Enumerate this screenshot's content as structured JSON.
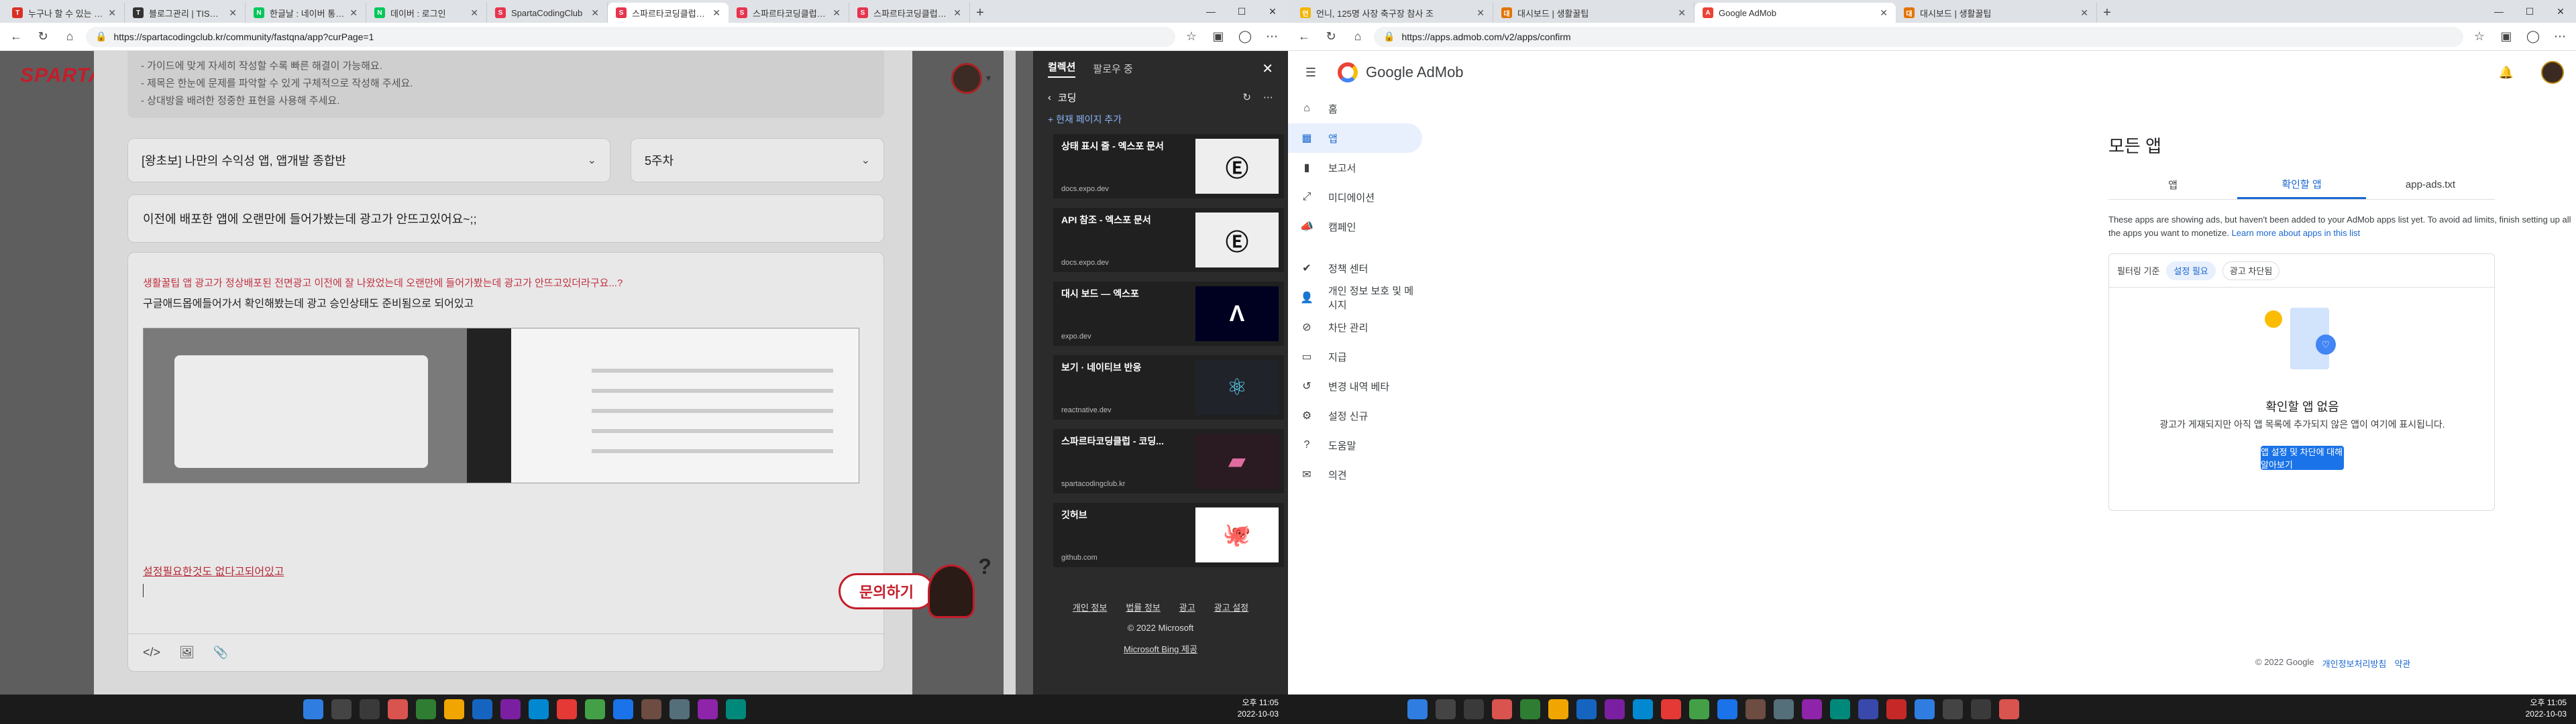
{
  "left": {
    "tabs": [
      {
        "label": "누구나 할 수 있는 앱 광고",
        "color": "#d93025",
        "icon": "T"
      },
      {
        "label": "블로그관리 | TISTORY",
        "color": "#333333",
        "icon": "T"
      },
      {
        "label": "한글날 : 네이버 통합검색",
        "color": "#03c75a",
        "icon": "N"
      },
      {
        "label": "데이버 : 로그인",
        "color": "#03c75a",
        "icon": "N"
      },
      {
        "label": "SpartaCodingClub",
        "color": "#e8344e",
        "icon": "S"
      },
      {
        "label": "스파르타코딩클럽 | 커뮤니",
        "color": "#e8344e",
        "icon": "S"
      },
      {
        "label": "스파르타코딩클럽 | 커뮤니",
        "color": "#e8344e",
        "icon": "S"
      },
      {
        "label": "스파르타코딩클럽 | 커뮤니",
        "color": "#e8344e",
        "icon": "S"
      }
    ],
    "url": "https://spartacodingclub.kr/community/fastqna/app?curPage=1",
    "brand": "SPARTA",
    "guide": [
      "- 가이드에 맞게 자세히 작성할 수록 빠른 해결이 가능해요.",
      "- 제목은 한눈에 문제를 파악할 수 있게 구체적으로 작성해 주세요.",
      "- 상대방을 배려한 정중한 표현을 사용해 주세요."
    ],
    "course": "[왕초보] 나만의 수익성 앱, 앱개발 종합반",
    "week": "5주차",
    "title": "이전에 배포한 앱에 오랜만에 들어가봤는데 광고가 안뜨고있어요~;;",
    "body1": "생활꿀팁 앱 광고가 정상배포된 전면광고 이전에 잘 나왔었는데 오랜만에 들어가봤는데 광고가 안뜨고있더라구요...?",
    "body2": "구글애드몹에들어가서 확인해봤는데 광고 승인상태도 준비됨으로 되어있고",
    "body3": "설정필요한것도 없다고되어있고",
    "ask": "문의하기",
    "collection": {
      "tab1": "컬렉션",
      "tab2": "팔로우 중",
      "name": "코딩",
      "add": "+ 현재 페이지 추가",
      "items": [
        {
          "title": "상태 표시 줄 - 엑스포 문서",
          "domain": "docs.expo.dev",
          "thumb": "Ⓔ",
          "bg": "#eeeeee",
          "fg": "#111111"
        },
        {
          "title": "API 참조 - 엑스포 문서",
          "domain": "docs.expo.dev",
          "thumb": "Ⓔ",
          "bg": "#eeeeee",
          "fg": "#111111"
        },
        {
          "title": "대시 보드 — 엑스포",
          "domain": "expo.dev",
          "thumb": "Λ",
          "bg": "#000020",
          "fg": "#ffffff"
        },
        {
          "title": "보기 · 네이티브 반응",
          "domain": "reactnative.dev",
          "thumb": "⚛",
          "bg": "#20232a",
          "fg": "#61dafb"
        },
        {
          "title": "스파르타코딩클럽 - 코딩...",
          "domain": "spartacodingclub.kr",
          "thumb": "▰",
          "bg": "#2a1a22",
          "fg": "#e06c9f"
        },
        {
          "title": "깃허브",
          "domain": "github.com",
          "thumb": "🐙",
          "bg": "#ffffff",
          "fg": "#111111"
        }
      ],
      "foot_links": [
        "개인 정보",
        "법률 정보",
        "광고",
        "광고 설정"
      ],
      "copyright": "© 2022 Microsoft",
      "bing": "Microsoft Bing 제공"
    },
    "clock_time": "오후 11:05",
    "clock_date": "2022-10-03"
  },
  "right": {
    "tabs": [
      {
        "label": "언니, 125명 사장 축구장 참사 조",
        "color": "#f4b400",
        "icon": "언"
      },
      {
        "label": "대시보드 | 생활꿀팁",
        "color": "#e37400",
        "icon": "대"
      },
      {
        "label": "Google AdMob",
        "color": "#ea4335",
        "icon": "A"
      },
      {
        "label": "대시보드 | 생활꿀팁",
        "color": "#e37400",
        "icon": "대"
      }
    ],
    "url": "https://apps.admob.com/v2/apps/confirm",
    "brand": "Google AdMob",
    "nav": [
      {
        "label": "홈",
        "icon": "⌂"
      },
      {
        "label": "앱",
        "icon": "▦"
      },
      {
        "label": "보고서",
        "icon": "▮"
      },
      {
        "label": "미디에이션",
        "icon": "⤢"
      },
      {
        "label": "캠페인",
        "icon": "📣"
      },
      {
        "label": "정책 센터",
        "icon": "✔"
      },
      {
        "label": "개인 정보 보호 및 메시지",
        "icon": "👤"
      },
      {
        "label": "차단 관리",
        "icon": "⊘"
      },
      {
        "label": "지급",
        "icon": "▭"
      },
      {
        "label": "변경 내역 베타",
        "icon": "↺"
      },
      {
        "label": "설정 신규",
        "icon": "⚙"
      },
      {
        "label": "도움말",
        "icon": "?"
      },
      {
        "label": "의견",
        "icon": "✉"
      }
    ],
    "page_title": "모든 앱",
    "tabs2": [
      "앱",
      "확인할 앱",
      "app-ads.txt"
    ],
    "desc": "These apps are showing ads, but haven't been added to your AdMob apps list yet. To avoid ad limits, finish setting up all the apps you want to monetize.",
    "learn": "Learn more about apps in this list",
    "filter_label": "필터링 기준",
    "chip1": "설정 필요",
    "chip2": "광고 차단됨",
    "empty_title": "확인할 앱 없음",
    "empty_sub": "광고가 게재되지만 아직 앱 목록에 추가되지 않은 앱이 여기에 표시됩니다.",
    "cta": "앱 설정 및 차단에 대해 알아보기",
    "foot_copy": "© 2022 Google",
    "foot_privacy": "개인정보처리방침",
    "foot_terms": "약관",
    "clock_time": "오후 11:05",
    "clock_date": "2022-10-03"
  }
}
